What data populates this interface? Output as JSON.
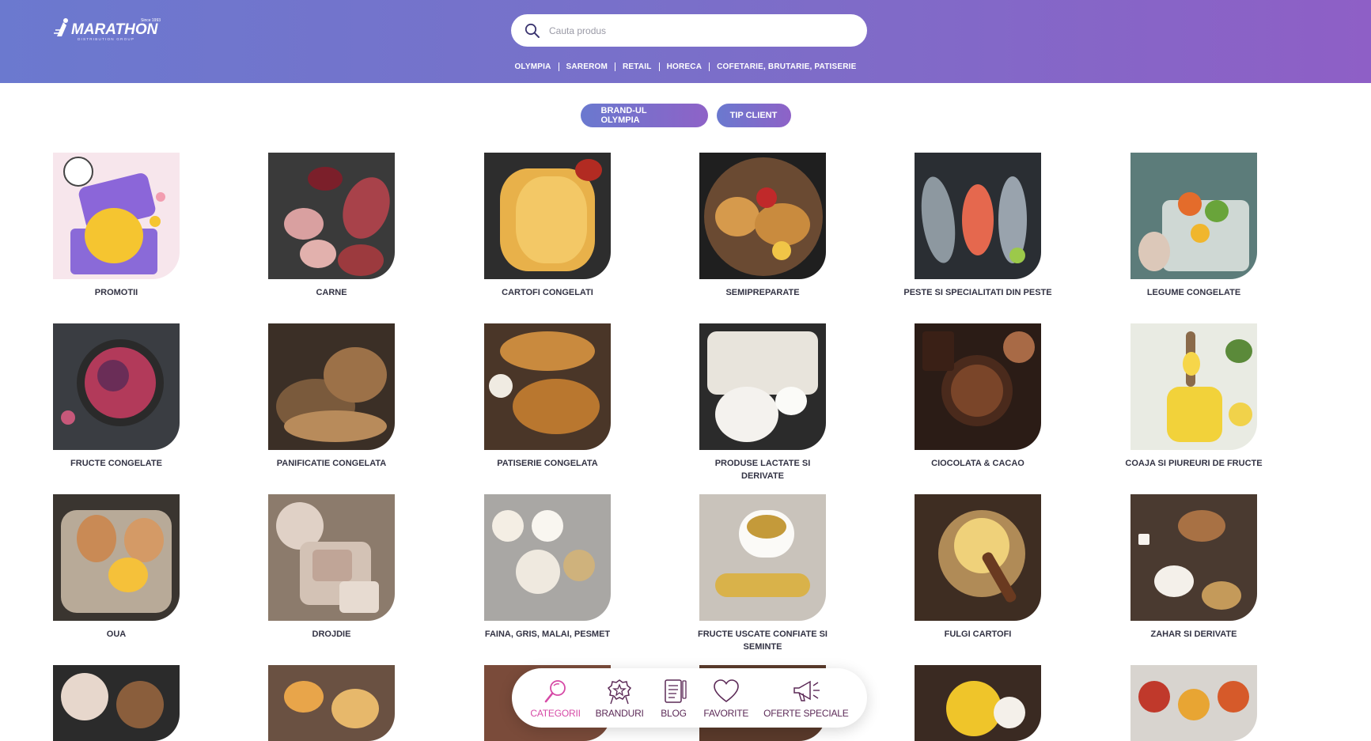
{
  "header": {
    "logo_text": "MARATHON",
    "logo_since": "Since 1993",
    "logo_sub": "DISTRIBUTION GROUP",
    "search_placeholder": "Cauta produs",
    "search_icon": "search-icon",
    "nav": [
      "OLYMPIA",
      "SAREROM",
      "RETAIL",
      "HORECA",
      "COFETARIE, BRUTARIE, PATISERIE"
    ]
  },
  "filters": {
    "brand_label": "BRAND-UL OLYMPIA",
    "client_label": "TIP CLIENT"
  },
  "categories": [
    {
      "label": "PROMOTII"
    },
    {
      "label": "CARNE"
    },
    {
      "label": "CARTOFI CONGELATI"
    },
    {
      "label": "SEMIPREPARATE"
    },
    {
      "label": "PESTE SI SPECIALITATI DIN PESTE"
    },
    {
      "label": "LEGUME CONGELATE"
    },
    {
      "label": "FRUCTE CONGELATE"
    },
    {
      "label": "PANIFICATIE CONGELATA"
    },
    {
      "label": "PATISERIE CONGELATA"
    },
    {
      "label": "PRODUSE LACTATE SI DERIVATE"
    },
    {
      "label": "CIOCOLATA & CACAO"
    },
    {
      "label": "COAJA SI PIUREURI DE FRUCTE"
    },
    {
      "label": "OUA"
    },
    {
      "label": "DROJDIE"
    },
    {
      "label": "FAINA, GRIS, MALAI, PESMET"
    },
    {
      "label": "FRUCTE USCATE CONFIATE SI SEMINTE"
    },
    {
      "label": "FULGI CARTOFI"
    },
    {
      "label": "ZAHAR SI DERIVATE"
    }
  ],
  "bottom_nav": {
    "items": [
      {
        "label": "CATEGORII",
        "icon": "magnifier-icon",
        "active": true
      },
      {
        "label": "BRANDURI",
        "icon": "badge-star-icon",
        "active": false
      },
      {
        "label": "BLOG",
        "icon": "document-pen-icon",
        "active": false
      },
      {
        "label": "FAVORITE",
        "icon": "heart-icon",
        "active": false
      },
      {
        "label": "OFERTE SPECIALE",
        "icon": "megaphone-icon",
        "active": false
      }
    ]
  },
  "colors": {
    "header_start": "#6b79cf",
    "header_end": "#8e5fc6",
    "active_nav": "#d64aa6",
    "nav_text": "#5c2a57"
  }
}
